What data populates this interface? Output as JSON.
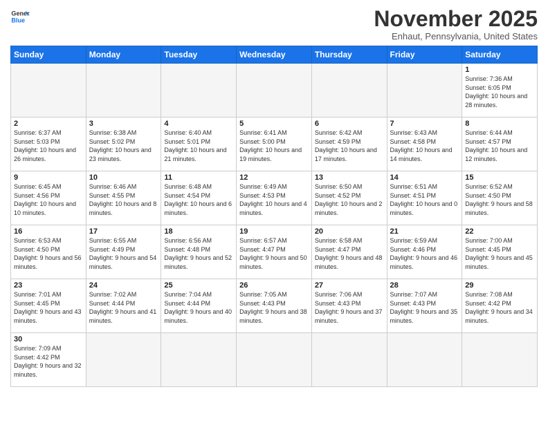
{
  "logo": {
    "text_general": "General",
    "text_blue": "Blue"
  },
  "title": "November 2025",
  "subtitle": "Enhaut, Pennsylvania, United States",
  "days_of_week": [
    "Sunday",
    "Monday",
    "Tuesday",
    "Wednesday",
    "Thursday",
    "Friday",
    "Saturday"
  ],
  "weeks": [
    [
      {
        "day": "",
        "info": ""
      },
      {
        "day": "",
        "info": ""
      },
      {
        "day": "",
        "info": ""
      },
      {
        "day": "",
        "info": ""
      },
      {
        "day": "",
        "info": ""
      },
      {
        "day": "",
        "info": ""
      },
      {
        "day": "1",
        "info": "Sunrise: 7:36 AM\nSunset: 6:05 PM\nDaylight: 10 hours and 28 minutes."
      }
    ],
    [
      {
        "day": "2",
        "info": "Sunrise: 6:37 AM\nSunset: 5:03 PM\nDaylight: 10 hours and 26 minutes."
      },
      {
        "day": "3",
        "info": "Sunrise: 6:38 AM\nSunset: 5:02 PM\nDaylight: 10 hours and 23 minutes."
      },
      {
        "day": "4",
        "info": "Sunrise: 6:40 AM\nSunset: 5:01 PM\nDaylight: 10 hours and 21 minutes."
      },
      {
        "day": "5",
        "info": "Sunrise: 6:41 AM\nSunset: 5:00 PM\nDaylight: 10 hours and 19 minutes."
      },
      {
        "day": "6",
        "info": "Sunrise: 6:42 AM\nSunset: 4:59 PM\nDaylight: 10 hours and 17 minutes."
      },
      {
        "day": "7",
        "info": "Sunrise: 6:43 AM\nSunset: 4:58 PM\nDaylight: 10 hours and 14 minutes."
      },
      {
        "day": "8",
        "info": "Sunrise: 6:44 AM\nSunset: 4:57 PM\nDaylight: 10 hours and 12 minutes."
      }
    ],
    [
      {
        "day": "9",
        "info": "Sunrise: 6:45 AM\nSunset: 4:56 PM\nDaylight: 10 hours and 10 minutes."
      },
      {
        "day": "10",
        "info": "Sunrise: 6:46 AM\nSunset: 4:55 PM\nDaylight: 10 hours and 8 minutes."
      },
      {
        "day": "11",
        "info": "Sunrise: 6:48 AM\nSunset: 4:54 PM\nDaylight: 10 hours and 6 minutes."
      },
      {
        "day": "12",
        "info": "Sunrise: 6:49 AM\nSunset: 4:53 PM\nDaylight: 10 hours and 4 minutes."
      },
      {
        "day": "13",
        "info": "Sunrise: 6:50 AM\nSunset: 4:52 PM\nDaylight: 10 hours and 2 minutes."
      },
      {
        "day": "14",
        "info": "Sunrise: 6:51 AM\nSunset: 4:51 PM\nDaylight: 10 hours and 0 minutes."
      },
      {
        "day": "15",
        "info": "Sunrise: 6:52 AM\nSunset: 4:50 PM\nDaylight: 9 hours and 58 minutes."
      }
    ],
    [
      {
        "day": "16",
        "info": "Sunrise: 6:53 AM\nSunset: 4:50 PM\nDaylight: 9 hours and 56 minutes."
      },
      {
        "day": "17",
        "info": "Sunrise: 6:55 AM\nSunset: 4:49 PM\nDaylight: 9 hours and 54 minutes."
      },
      {
        "day": "18",
        "info": "Sunrise: 6:56 AM\nSunset: 4:48 PM\nDaylight: 9 hours and 52 minutes."
      },
      {
        "day": "19",
        "info": "Sunrise: 6:57 AM\nSunset: 4:47 PM\nDaylight: 9 hours and 50 minutes."
      },
      {
        "day": "20",
        "info": "Sunrise: 6:58 AM\nSunset: 4:47 PM\nDaylight: 9 hours and 48 minutes."
      },
      {
        "day": "21",
        "info": "Sunrise: 6:59 AM\nSunset: 4:46 PM\nDaylight: 9 hours and 46 minutes."
      },
      {
        "day": "22",
        "info": "Sunrise: 7:00 AM\nSunset: 4:45 PM\nDaylight: 9 hours and 45 minutes."
      }
    ],
    [
      {
        "day": "23",
        "info": "Sunrise: 7:01 AM\nSunset: 4:45 PM\nDaylight: 9 hours and 43 minutes."
      },
      {
        "day": "24",
        "info": "Sunrise: 7:02 AM\nSunset: 4:44 PM\nDaylight: 9 hours and 41 minutes."
      },
      {
        "day": "25",
        "info": "Sunrise: 7:04 AM\nSunset: 4:44 PM\nDaylight: 9 hours and 40 minutes."
      },
      {
        "day": "26",
        "info": "Sunrise: 7:05 AM\nSunset: 4:43 PM\nDaylight: 9 hours and 38 minutes."
      },
      {
        "day": "27",
        "info": "Sunrise: 7:06 AM\nSunset: 4:43 PM\nDaylight: 9 hours and 37 minutes."
      },
      {
        "day": "28",
        "info": "Sunrise: 7:07 AM\nSunset: 4:43 PM\nDaylight: 9 hours and 35 minutes."
      },
      {
        "day": "29",
        "info": "Sunrise: 7:08 AM\nSunset: 4:42 PM\nDaylight: 9 hours and 34 minutes."
      }
    ],
    [
      {
        "day": "30",
        "info": "Sunrise: 7:09 AM\nSunset: 4:42 PM\nDaylight: 9 hours and 32 minutes."
      },
      {
        "day": "",
        "info": ""
      },
      {
        "day": "",
        "info": ""
      },
      {
        "day": "",
        "info": ""
      },
      {
        "day": "",
        "info": ""
      },
      {
        "day": "",
        "info": ""
      },
      {
        "day": "",
        "info": ""
      }
    ]
  ]
}
